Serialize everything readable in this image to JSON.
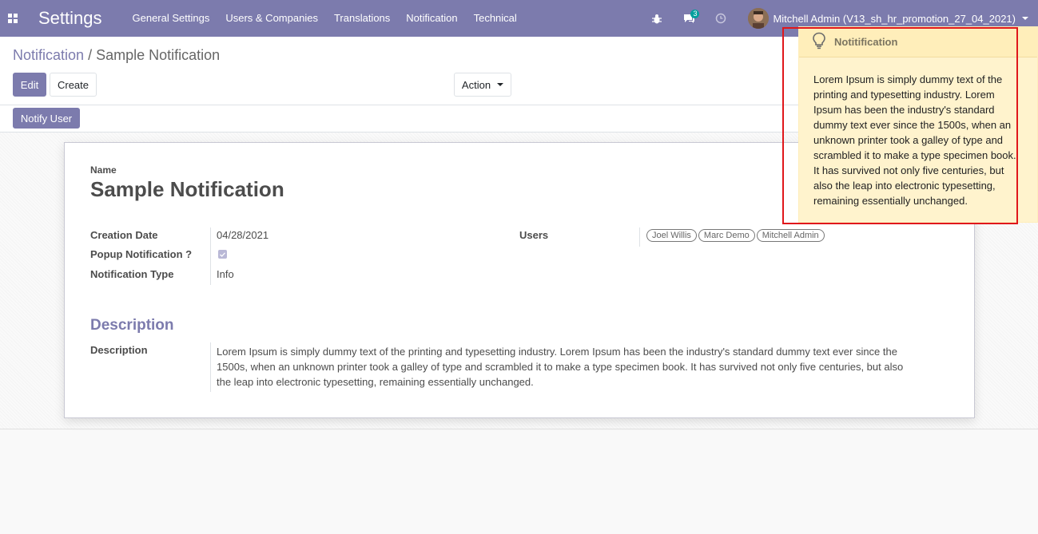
{
  "navbar": {
    "app_title": "Settings",
    "menu": [
      "General Settings",
      "Users & Companies",
      "Translations",
      "Notification",
      "Technical"
    ],
    "chat_badge": "3",
    "user_label": "Mitchell Admin (V13_sh_hr_promotion_27_04_2021)"
  },
  "breadcrumb": {
    "parent": "Notification",
    "separator": "/",
    "current": "Sample Notification"
  },
  "buttons": {
    "edit": "Edit",
    "create": "Create",
    "action": "Action",
    "notify_user": "Notify User"
  },
  "form": {
    "name_label": "Name",
    "name_value": "Sample Notification",
    "creation_date_label": "Creation Date",
    "creation_date_value": "04/28/2021",
    "popup_label": "Popup Notification ?",
    "popup_checked": true,
    "type_label": "Notification Type",
    "type_value": "Info",
    "users_label": "Users",
    "users": [
      "Joel Willis",
      "Marc Demo",
      "Mitchell Admin"
    ],
    "section_title": "Description",
    "description_label": "Description",
    "description_lines": [
      "Lorem Ipsum is simply dummy text of the printing and typesetting industry. Lorem Ipsum has been the industry's standard dummy text ever since the",
      "1500s, when an unknown printer took a galley of type and scrambled it to make a type specimen book. It has survived not only five centuries, but also",
      "the leap into electronic typesetting, remaining essentially unchanged."
    ]
  },
  "notification_popup": {
    "title": "Notitification",
    "body_lines": [
      "Lorem Ipsum is simply dummy text of the",
      "printing and typesetting industry. Lorem",
      "Ipsum has been the industry's standard",
      "dummy text ever since the 1500s, when an",
      "unknown printer took a galley of type and",
      "scrambled it to make a type specimen book.",
      "It has survived not only five centuries, but",
      "also the leap into electronic typesetting,",
      "remaining essentially unchanged."
    ]
  },
  "colors": {
    "brand": "#7c7bad",
    "popup_bg": "#fff3cd",
    "highlight": "#e0171b"
  }
}
